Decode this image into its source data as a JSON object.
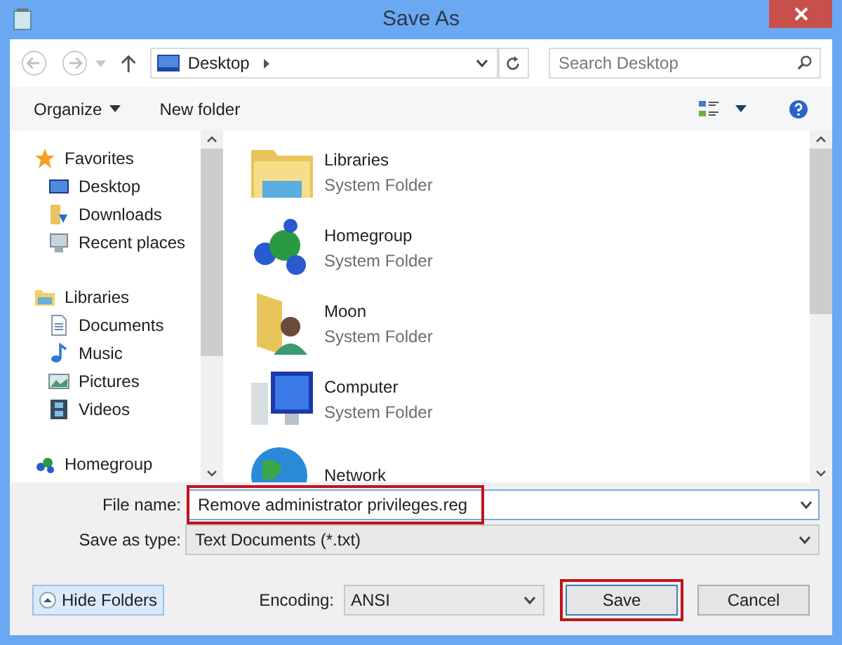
{
  "window": {
    "title": "Save As"
  },
  "address_bar": {
    "path": "Desktop"
  },
  "search": {
    "placeholder": "Search Desktop"
  },
  "toolbar": {
    "organize": "Organize",
    "new_folder": "New folder"
  },
  "sidebar": {
    "items": [
      {
        "label": "Favorites",
        "children": [
          {
            "label": "Desktop"
          },
          {
            "label": "Downloads"
          },
          {
            "label": "Recent places"
          }
        ]
      },
      {
        "label": "Libraries",
        "children": [
          {
            "label": "Documents"
          },
          {
            "label": "Music"
          },
          {
            "label": "Pictures"
          },
          {
            "label": "Videos"
          }
        ]
      },
      {
        "label": "Homegroup"
      }
    ]
  },
  "files": [
    {
      "name": "Libraries",
      "type": "System Folder"
    },
    {
      "name": "Homegroup",
      "type": "System Folder"
    },
    {
      "name": "Moon",
      "type": "System Folder"
    },
    {
      "name": "Computer",
      "type": "System Folder"
    },
    {
      "name": "Network"
    }
  ],
  "file_name": {
    "label": "File name:",
    "value": "Remove administrator privileges.reg",
    "highlighted": true
  },
  "save_as_type": {
    "label": "Save as type:",
    "value": "Text Documents (*.txt)"
  },
  "hide_folders": "Hide Folders",
  "encoding": {
    "label": "Encoding:",
    "value": "ANSI"
  },
  "buttons": [
    {
      "label": "Save",
      "highlighted": true
    },
    {
      "label": "Cancel",
      "highlighted": false
    }
  ]
}
